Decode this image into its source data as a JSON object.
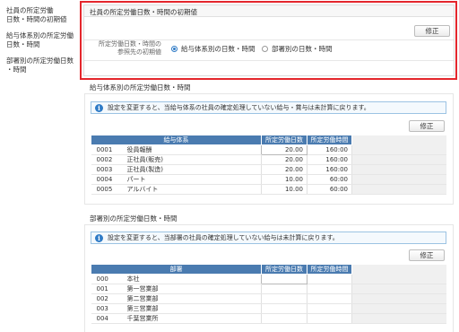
{
  "sidebar": {
    "items": [
      {
        "line1": "社員の所定労働",
        "line2": "日数・時間の初期値"
      },
      {
        "line1": "給与体系別の所定労働",
        "line2": "日数・時間"
      },
      {
        "line1": "部署別の所定労働日数",
        "line2": "・時間"
      }
    ]
  },
  "init_section": {
    "title": "社員の所定労働日数・時間の初期値",
    "edit_label": "修正",
    "ref_label_line1": "所定労働日数・時間の",
    "ref_label_line2": "参照先の初期値",
    "options": [
      {
        "label": "給与体系別の日数・時間",
        "selected": true
      },
      {
        "label": "部署別の日数・時間",
        "selected": false
      }
    ]
  },
  "salary_section": {
    "title": "給与体系別の所定労働日数・時間",
    "info": "設定を変更すると、当給与体系の社員の確定処理していない給与・賞与は未計算に戻ります。",
    "edit_label": "修正",
    "columns": [
      "給与体系",
      "所定労働日数",
      "所定労働時間"
    ],
    "rows": [
      {
        "code": "0001",
        "name": "役員報酬",
        "days": "20.00",
        "hours": "160:00"
      },
      {
        "code": "0002",
        "name": "正社員(販売)",
        "days": "20.00",
        "hours": "160:00"
      },
      {
        "code": "0003",
        "name": "正社員(製造)",
        "days": "20.00",
        "hours": "160:00"
      },
      {
        "code": "0004",
        "name": "パート",
        "days": "10.00",
        "hours": "60:00"
      },
      {
        "code": "0005",
        "name": "アルバイト",
        "days": "10.00",
        "hours": "60:00"
      }
    ]
  },
  "dept_section": {
    "title": "部署別の所定労働日数・時間",
    "info": "設定を変更すると、当部署の社員の確定処理していない給与は未計算に戻ります。",
    "edit_label": "修正",
    "columns": [
      "部署",
      "所定労働日数",
      "所定労働時間"
    ],
    "rows": [
      {
        "code": "000",
        "name": "本社"
      },
      {
        "code": "001",
        "name": "第一営業部"
      },
      {
        "code": "002",
        "name": "第二営業部"
      },
      {
        "code": "003",
        "name": "第三営業部"
      },
      {
        "code": "004",
        "name": "千葉営業所"
      }
    ]
  }
}
